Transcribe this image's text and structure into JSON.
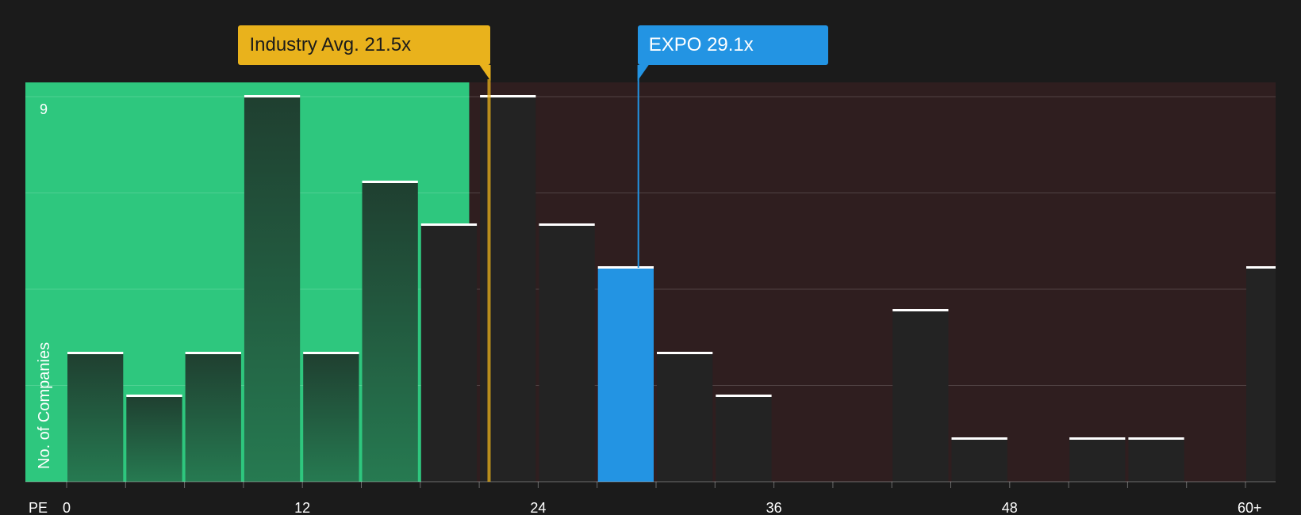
{
  "chart_data": {
    "type": "bar",
    "x_axis_label": "PE",
    "ylabel": "No. of Companies",
    "y_top_tick": "9",
    "ylim": [
      0,
      9.3
    ],
    "xlim": [
      0,
      61.5
    ],
    "bin_width": 3,
    "x_ticks": [
      {
        "value": 0,
        "label": "0"
      },
      {
        "value": 12,
        "label": "12"
      },
      {
        "value": 24,
        "label": "24"
      },
      {
        "value": 36,
        "label": "36"
      },
      {
        "value": 48,
        "label": "48"
      },
      {
        "value": 60,
        "label": "60+"
      }
    ],
    "bins": [
      {
        "start": 0,
        "count": 3
      },
      {
        "start": 3,
        "count": 2
      },
      {
        "start": 6,
        "count": 3
      },
      {
        "start": 9,
        "count": 9
      },
      {
        "start": 12,
        "count": 3
      },
      {
        "start": 15,
        "count": 7
      },
      {
        "start": 18,
        "count": 6
      },
      {
        "start": 21,
        "count": 9
      },
      {
        "start": 24,
        "count": 6
      },
      {
        "start": 27,
        "count": 5,
        "highlight": true
      },
      {
        "start": 30,
        "count": 3
      },
      {
        "start": 33,
        "count": 2
      },
      {
        "start": 36,
        "count": 0
      },
      {
        "start": 39,
        "count": 0
      },
      {
        "start": 42,
        "count": 4
      },
      {
        "start": 45,
        "count": 1
      },
      {
        "start": 48,
        "count": 0
      },
      {
        "start": 51,
        "count": 1
      },
      {
        "start": 54,
        "count": 1
      },
      {
        "start": 57,
        "count": 0
      },
      {
        "start": 60,
        "count": 5
      }
    ],
    "industry_avg": {
      "value": 21.5,
      "label": "Industry Avg. 21.5x"
    },
    "company": {
      "value": 29.1,
      "label": "EXPO 29.1x"
    },
    "colors": {
      "background": "#1b1b1b",
      "undervalued_zone": "#2ec77e",
      "overvalued_zone": "#2f1e1f",
      "bar_dark": "#232323",
      "highlight_bar": "#2394e3",
      "industry_line": "#e9b21c",
      "bar_cap": "#ffffff"
    }
  }
}
